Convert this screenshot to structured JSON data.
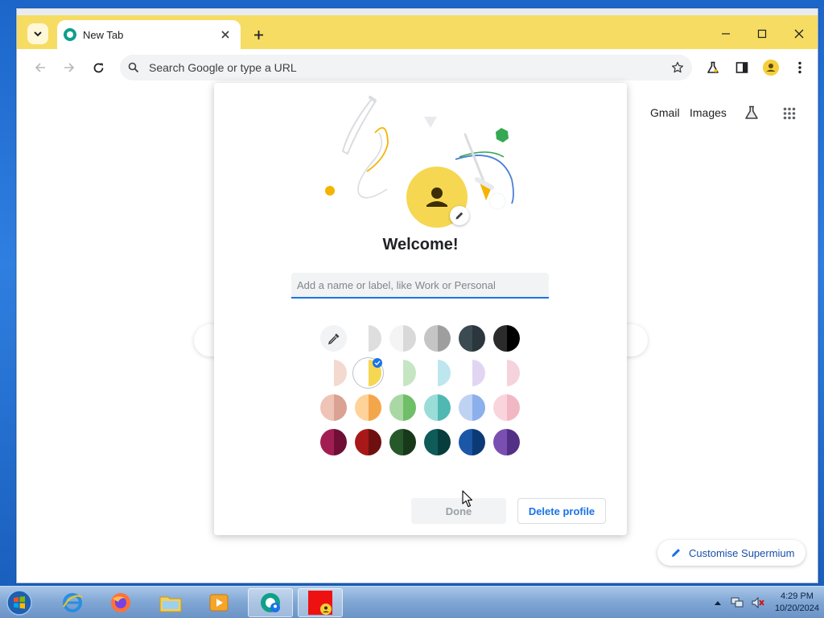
{
  "browser": {
    "tab": {
      "title": "New Tab"
    },
    "omnibox": {
      "placeholder": "Search Google or type a URL"
    }
  },
  "ntp": {
    "links": {
      "gmail": "Gmail",
      "images": "Images"
    },
    "customise_label": "Customise Supermium"
  },
  "dialog": {
    "title": "Welcome!",
    "name_input_placeholder": "Add a name or label, like Work or Personal",
    "name_input_value": "",
    "done_label": "Done",
    "delete_label": "Delete profile",
    "selected_swatch": "yellow-white",
    "swatches": [
      {
        "id": "eyedropper",
        "icon": "eyedropper-icon"
      },
      {
        "id": "white-light",
        "left": "#ffffff",
        "right": "#dedede"
      },
      {
        "id": "white-grey",
        "left": "#f4f4f4",
        "right": "#d9d9d9"
      },
      {
        "id": "grey",
        "left": "#c5c5c5",
        "right": "#9e9e9e"
      },
      {
        "id": "slate",
        "left": "#3c4a52",
        "right": "#2b363d"
      },
      {
        "id": "black",
        "left": "#2b2b2b",
        "right": "#000000"
      },
      {
        "id": "peach-light",
        "left": "#ffffff",
        "right": "#f3d9cf"
      },
      {
        "id": "yellow-white",
        "left": "#ffffff",
        "right": "#f6d752"
      },
      {
        "id": "green-light",
        "left": "#ffffff",
        "right": "#c6e6c3"
      },
      {
        "id": "cyan-light",
        "left": "#ffffff",
        "right": "#bde6ee"
      },
      {
        "id": "lavender-light",
        "left": "#ffffff",
        "right": "#e2d5f4"
      },
      {
        "id": "pink-light",
        "left": "#ffffff",
        "right": "#f5d3db"
      },
      {
        "id": "salmon",
        "left": "#efc4b7",
        "right": "#d9a292"
      },
      {
        "id": "orange",
        "left": "#ffd29a",
        "right": "#f4a64a"
      },
      {
        "id": "green",
        "left": "#a9d8a4",
        "right": "#6fbe68"
      },
      {
        "id": "teal",
        "left": "#9adcd8",
        "right": "#50b8b2"
      },
      {
        "id": "blue-light",
        "left": "#bed2f4",
        "right": "#8cb0ec"
      },
      {
        "id": "pink",
        "left": "#f9d4dc",
        "right": "#f1b8c4"
      },
      {
        "id": "magenta",
        "left": "#a21e52",
        "right": "#6f0f35"
      },
      {
        "id": "red",
        "left": "#a81818",
        "right": "#6f1010"
      },
      {
        "id": "dark-green",
        "left": "#27582a",
        "right": "#17391a"
      },
      {
        "id": "dark-teal",
        "left": "#0e5b5a",
        "right": "#073d3c"
      },
      {
        "id": "navy",
        "left": "#1b57a6",
        "right": "#0c3a75"
      },
      {
        "id": "purple",
        "left": "#7a4fb2",
        "right": "#542f86"
      }
    ]
  },
  "taskbar": {
    "apps": [
      "internet-explorer-icon",
      "firefox-icon",
      "file-explorer-icon",
      "media-player-icon",
      "supermium-icon",
      "profile-window-icon"
    ],
    "clock": {
      "time": "4:29 PM",
      "date": "10/20/2024"
    }
  },
  "colors": {
    "accent": "#1a73e8",
    "tabstrip": "#f6dc63",
    "avatar": "#f4cf3a"
  }
}
